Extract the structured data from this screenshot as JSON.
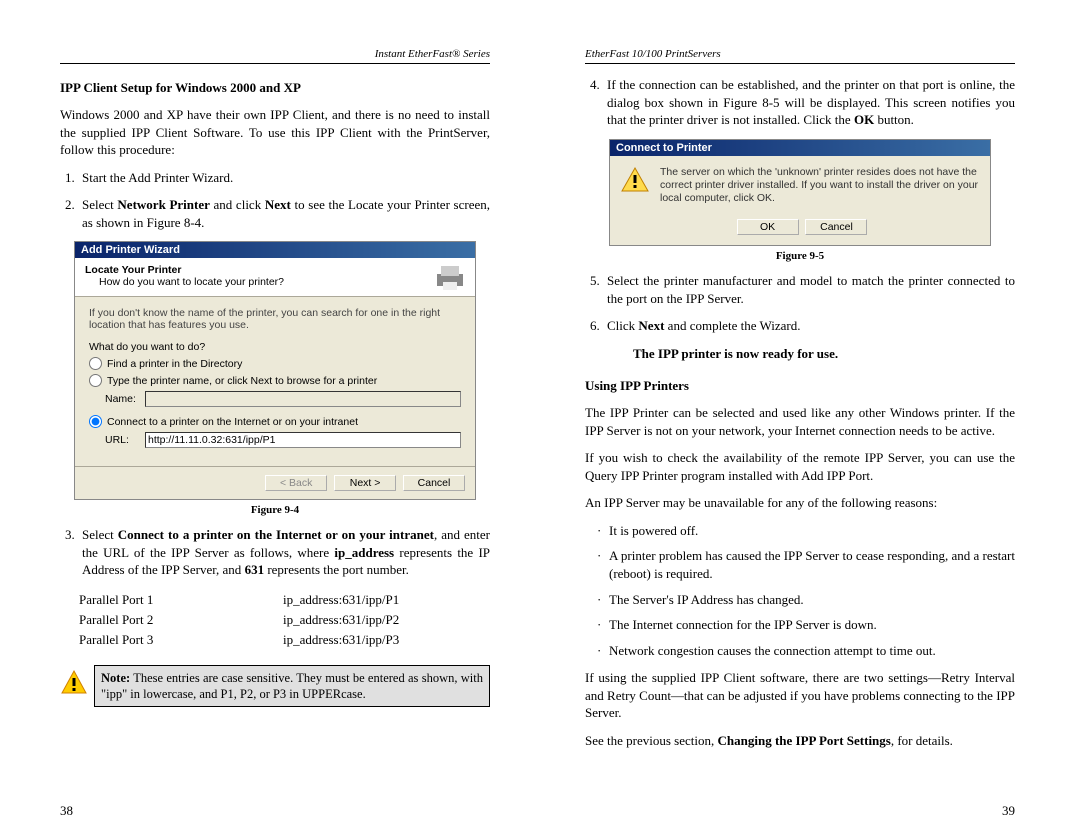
{
  "left": {
    "header": "Instant EtherFast® Series",
    "h1": "IPP Client Setup for Windows 2000 and XP",
    "p_intro": "Windows 2000 and XP have their own IPP Client, and there is no need to install the supplied IPP Client Software. To use this IPP Client with the PrintServer, follow this procedure:",
    "s1": "Start the Add Printer Wizard.",
    "s2_a": "Select ",
    "s2_b": "Network Printer",
    "s2_c": " and click ",
    "s2_d": "Next",
    "s2_e": " to see the Locate your Printer screen, as shown in Figure 8-4.",
    "fig84_cap": "Figure 9-4",
    "d84": {
      "title": "Add Printer Wizard",
      "heading": "Locate Your Printer",
      "sub": "How do you want to locate your printer?",
      "help": "If you don't know the name of the printer, you can search for one in the right location that has features you use.",
      "prompt": "What do you want to do?",
      "opt1": "Find a printer in the Directory",
      "opt2": "Type the printer name, or click Next to browse for a printer",
      "opt3": "Connect to a printer on the Internet or on your intranet",
      "name_label": "Name:",
      "url_label": "URL:",
      "url_val": "http://11.11.0.32:631/ipp/P1",
      "back": "< Back",
      "next": "Next >",
      "cancel": "Cancel"
    },
    "s3_a": "Select ",
    "s3_b": "Connect to a printer on the Internet or on your intranet",
    "s3_c": ", and enter the URL of the IPP Server as follows, where ",
    "s3_d": "ip_address",
    "s3_e": " represents the IP Address of the IPP Server, and ",
    "s3_f": "631",
    "s3_g": " represents the port number.",
    "ports": [
      {
        "label": "Parallel Port 1",
        "addr": "ip_address:631/ipp/P1"
      },
      {
        "label": "Parallel Port 2",
        "addr": "ip_address:631/ipp/P2"
      },
      {
        "label": "Parallel Port 3",
        "addr": "ip_address:631/ipp/P3"
      }
    ],
    "note_a": "Note:",
    "note_b": " These entries are case sensitive. They must be entered as shown, with \"ipp\" in lowercase, and P1, P2, or P3 in UPPERcase.",
    "page_num": "38"
  },
  "right": {
    "header": "EtherFast 10/100 PrintServers",
    "s4_a": "If the connection can be established, and the printer on that port is online, the dialog box shown in Figure 8-5 will be displayed. This screen notifies you that the printer driver is not installed. Click the ",
    "s4_b": "OK",
    "s4_c": " button.",
    "d85": {
      "title": "Connect to Printer",
      "msg": "The server on which the 'unknown' printer resides does not have the correct printer driver installed. If you want to install the driver on your local computer, click OK.",
      "ok": "OK",
      "cancel": "Cancel"
    },
    "fig85_cap": "Figure 9-5",
    "s5": "Select the printer manufacturer and model to match the printer connected to the port on the IPP Server.",
    "s6_a": "Click ",
    "s6_b": "Next",
    "s6_c": " and complete the Wizard.",
    "ready": "The IPP printer is now ready for use.",
    "h2": "Using IPP Printers",
    "p2": "The IPP Printer can be selected and used like any other Windows printer. If the IPP Server is not on your network, your Internet connection needs to be active.",
    "p3": "If you wish to check the availability of the remote IPP Server, you can use the Query IPP Printer program installed with Add IPP Port.",
    "p4": "An IPP Server may be unavailable for any of the following reasons:",
    "reasons": [
      "It is powered off.",
      "A printer problem has caused the IPP Server to cease responding, and a restart (reboot) is required.",
      "The Server's IP Address has changed.",
      "The Internet connection for the IPP Server is down.",
      "Network congestion causes the connection attempt to time out."
    ],
    "p5": "If using the supplied IPP Client software, there are two settings—Retry Interval and Retry Count—that can be adjusted if you have problems connecting to the IPP Server.",
    "p6_a": "See the previous section, ",
    "p6_b": "Changing the IPP Port Settings",
    "p6_c": ", for details.",
    "page_num": "39"
  }
}
